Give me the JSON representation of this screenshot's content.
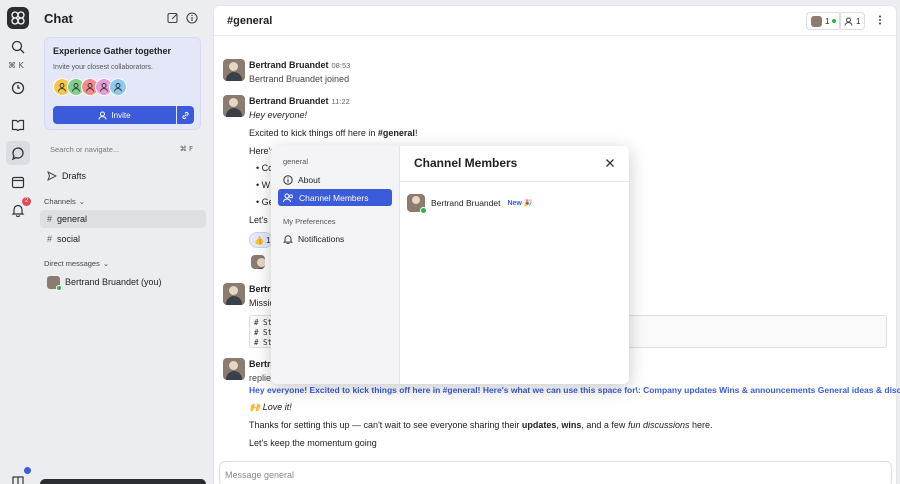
{
  "sidebar": {
    "title": "Chat",
    "promo": {
      "title": "Experience Gather together",
      "subtitle": "Invite your closest collaborators.",
      "invite_label": "Invite",
      "avatar_colors": [
        "#f5c84c",
        "#7fd08a",
        "#f38b8b",
        "#e59bd6",
        "#8fc9f0"
      ]
    },
    "search_placeholder": "Search or navigate...",
    "search_shortcut": "⌘ F",
    "rail_shortcut": "⌘ K",
    "notification_count": "2",
    "drafts_label": "Drafts",
    "channels_label": "Channels",
    "channels": [
      {
        "name": "general",
        "selected": true
      },
      {
        "name": "social",
        "selected": false
      }
    ],
    "dm_label": "Direct messages",
    "dms": [
      {
        "name": "Bertrand Bruandet (you)"
      }
    ]
  },
  "header": {
    "channel": "general",
    "avatar_count": "1",
    "member_count": "1"
  },
  "messages": {
    "m1": {
      "author": "Bertrand Bruandet",
      "time": "08:53",
      "text": "Bertrand Bruandet joined"
    },
    "m2": {
      "author": "Bertrand Bruandet",
      "time": "11:22",
      "line1": "Hey everyone!",
      "line2_pre": "Excited to kick things off here in ",
      "line2_bold": "#general",
      "line2_post": "!",
      "line3": "Here's",
      "b1": "Co",
      "b2": "W",
      "b3": "Ge",
      "line4": "Let's",
      "reaction_emoji": "👍",
      "reaction_count": "1"
    },
    "m3": {
      "author": "Bertrand",
      "text": "Missio",
      "code1": "# St",
      "code2": "# St",
      "code3": "# St"
    },
    "m4": {
      "author": "Bertrand",
      "replied": "replie",
      "quote": "Hey everyone! Excited to kick things off here in #general! Here's what we can use this space for\\: Company updates Wins & announcements General ideas & discussi",
      "love": "🙌 Love it!",
      "l2_a": "Thanks for setting this up — can't wait to see everyone sharing their ",
      "l2_b": "updates",
      "l2_c": ", ",
      "l2_d": "wins",
      "l2_e": ", and a few ",
      "l2_f": "fun discussions",
      "l2_g": " here.",
      "l3": "Let's keep the momentum going"
    }
  },
  "composer": {
    "placeholder": "Message general"
  },
  "modal": {
    "section_general": "general",
    "about_label": "About",
    "members_label": "Channel Members",
    "section_prefs": "My Preferences",
    "notifications_label": "Notifications",
    "title": "Channel Members",
    "member_name": "Bertrand Bruandet",
    "member_badge": "New 🎉",
    "accent": "#3b5bdb"
  }
}
